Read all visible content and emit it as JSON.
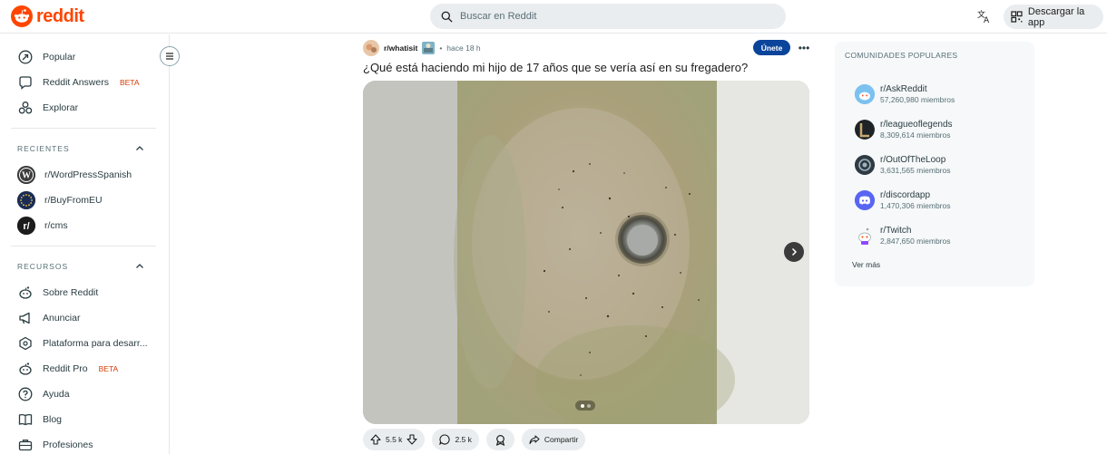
{
  "header": {
    "logo_text": "reddit",
    "search_placeholder": "Buscar en Reddit",
    "get_app_label": "Descargar la app",
    "brand_color": "#ff4500"
  },
  "sidebar": {
    "top_items": [
      {
        "label": "Popular",
        "icon": "popular-icon"
      },
      {
        "label": "Reddit Answers",
        "badge": "BETA",
        "icon": "answers-icon"
      },
      {
        "label": "Explorar",
        "icon": "explore-icon"
      }
    ],
    "recent_header": "RECIENTES",
    "recent_items": [
      {
        "label": "r/WordPressSpanish",
        "icon": "wordpress-icon"
      },
      {
        "label": "r/BuyFromEU",
        "icon": "eu-icon"
      },
      {
        "label": "r/cms",
        "icon": "cms-icon"
      }
    ],
    "resources_header": "RECURSOS",
    "resource_items": [
      {
        "label": "Sobre Reddit",
        "icon": "reddit-icon"
      },
      {
        "label": "Anunciar",
        "icon": "megaphone-icon"
      },
      {
        "label": "Plataforma para desarr...",
        "icon": "developer-icon"
      },
      {
        "label": "Reddit Pro",
        "badge": "BETA",
        "icon": "pro-icon"
      },
      {
        "label": "Ayuda",
        "icon": "help-icon"
      },
      {
        "label": "Blog",
        "icon": "book-icon"
      },
      {
        "label": "Profesiones",
        "icon": "briefcase-icon"
      }
    ]
  },
  "post": {
    "subreddit": "r/whatisit",
    "time": "hace 18 h",
    "join_label": "Únete",
    "title": "¿Qué está haciendo mi hijo de 17 años que se vería así en su fregadero?",
    "upvotes": "5.5 k",
    "comments": "2.5 k",
    "share_label": "Compartir",
    "slides_total": 2,
    "slide_active": 1
  },
  "popular_communities": {
    "header": "COMUNIDADES POPULARES",
    "items": [
      {
        "name": "r/AskReddit",
        "members": "57,260,980 miembros",
        "icon": "askreddit-icon"
      },
      {
        "name": "r/leagueoflegends",
        "members": "8,309,614 miembros",
        "icon": "leagueoflegends-icon"
      },
      {
        "name": "r/OutOfTheLoop",
        "members": "3,631,565 miembros",
        "icon": "outoftheloop-icon"
      },
      {
        "name": "r/discordapp",
        "members": "1,470,306 miembros",
        "icon": "discord-icon"
      },
      {
        "name": "r/Twitch",
        "members": "2,847,650 miembros",
        "icon": "twitch-icon"
      }
    ],
    "see_more": "Ver más"
  }
}
